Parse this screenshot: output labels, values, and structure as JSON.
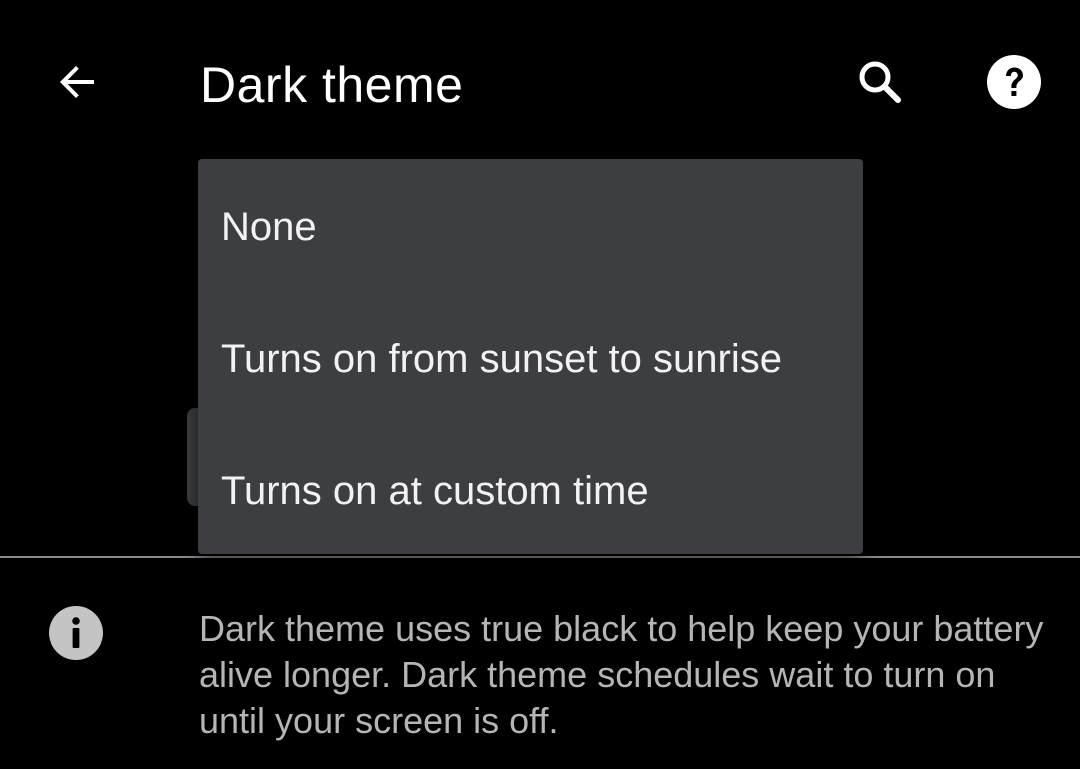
{
  "header": {
    "title": "Dark theme",
    "back_icon": "arrow-back-icon",
    "search_icon": "search-icon",
    "help_icon": "help-icon"
  },
  "menu": {
    "items": [
      {
        "label": "None"
      },
      {
        "label": "Turns on from sunset to sunrise"
      },
      {
        "label": "Turns on at custom time"
      }
    ]
  },
  "info": {
    "icon": "info-icon",
    "text": "Dark theme uses true black to help keep your battery alive longer. Dark theme schedules wait to turn on until your screen is off."
  },
  "colors": {
    "background": "#000000",
    "menu_background": "#3c3e42",
    "text_primary": "#ffffff",
    "text_secondary": "#b5b5b5"
  }
}
